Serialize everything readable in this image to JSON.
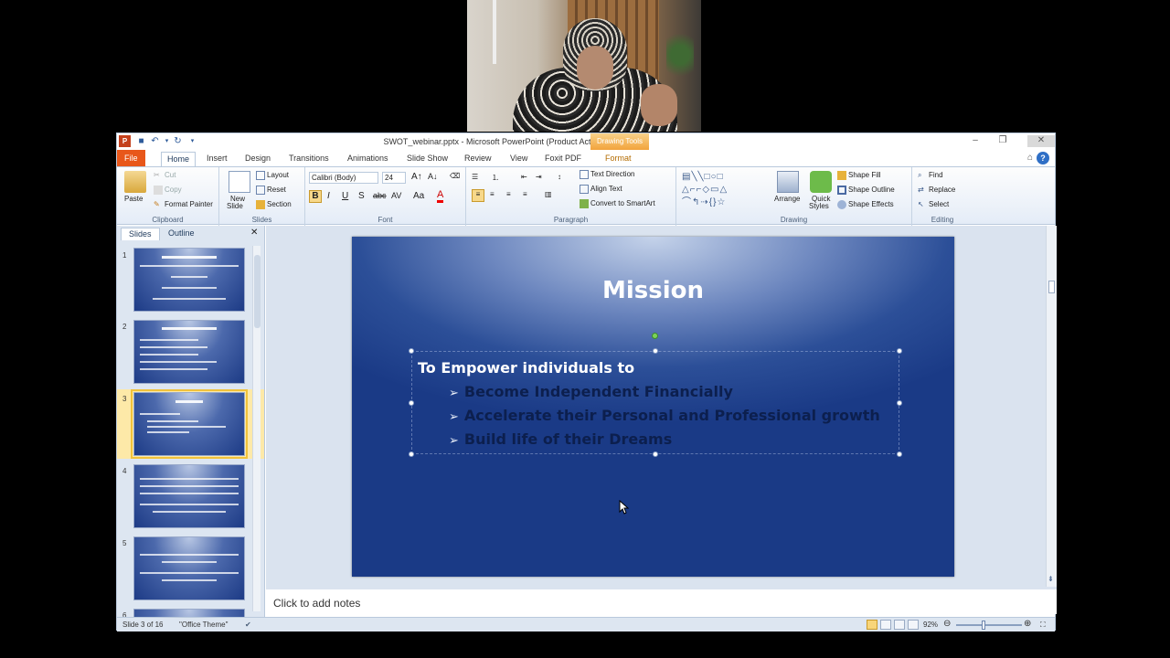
{
  "window": {
    "title": "SWOT_webinar.pptx - Microsoft PowerPoint (Product Activation Failed)",
    "contextual_tab_group": "Drawing Tools"
  },
  "tabs": [
    {
      "label": "File"
    },
    {
      "label": "Home"
    },
    {
      "label": "Insert"
    },
    {
      "label": "Design"
    },
    {
      "label": "Transitions"
    },
    {
      "label": "Animations"
    },
    {
      "label": "Slide Show"
    },
    {
      "label": "Review"
    },
    {
      "label": "View"
    },
    {
      "label": "Foxit PDF"
    },
    {
      "label": "Format"
    }
  ],
  "ribbon": {
    "clipboard": {
      "label": "Clipboard",
      "paste": "Paste",
      "cut": "Cut",
      "copy": "Copy",
      "format_painter": "Format Painter"
    },
    "slides": {
      "label": "Slides",
      "new_slide": "New",
      "new_slide2": "Slide",
      "layout": "Layout",
      "reset": "Reset",
      "section": "Section"
    },
    "font": {
      "label": "Font",
      "font_name": "Calibri (Body)",
      "font_size": "24"
    },
    "paragraph": {
      "label": "Paragraph",
      "text_direction": "Text Direction",
      "align_text": "Align Text",
      "convert_smartart": "Convert to SmartArt"
    },
    "drawing": {
      "label": "Drawing",
      "arrange": "Arrange",
      "quick_styles": "Quick",
      "quick_styles2": "Styles",
      "shape_fill": "Shape Fill",
      "shape_outline": "Shape Outline",
      "shape_effects": "Shape Effects"
    },
    "editing": {
      "label": "Editing",
      "find": "Find",
      "replace": "Replace",
      "select": "Select"
    }
  },
  "slides_pane": {
    "tabs": [
      "Slides",
      "Outline"
    ],
    "thumbnails": [
      {
        "num": "1"
      },
      {
        "num": "2"
      },
      {
        "num": "3"
      },
      {
        "num": "4"
      },
      {
        "num": "5"
      },
      {
        "num": "6"
      }
    ]
  },
  "slide": {
    "title": "Mission",
    "lead": "To Empower individuals to",
    "bullets": [
      "Become Independent Financially",
      "Accelerate their Personal and Professional growth",
      "Build life of their Dreams"
    ]
  },
  "notes": {
    "placeholder": "Click to add notes"
  },
  "status": {
    "slide_info": "Slide 3 of 16",
    "theme": "\"Office Theme\"",
    "zoom": "92%"
  }
}
